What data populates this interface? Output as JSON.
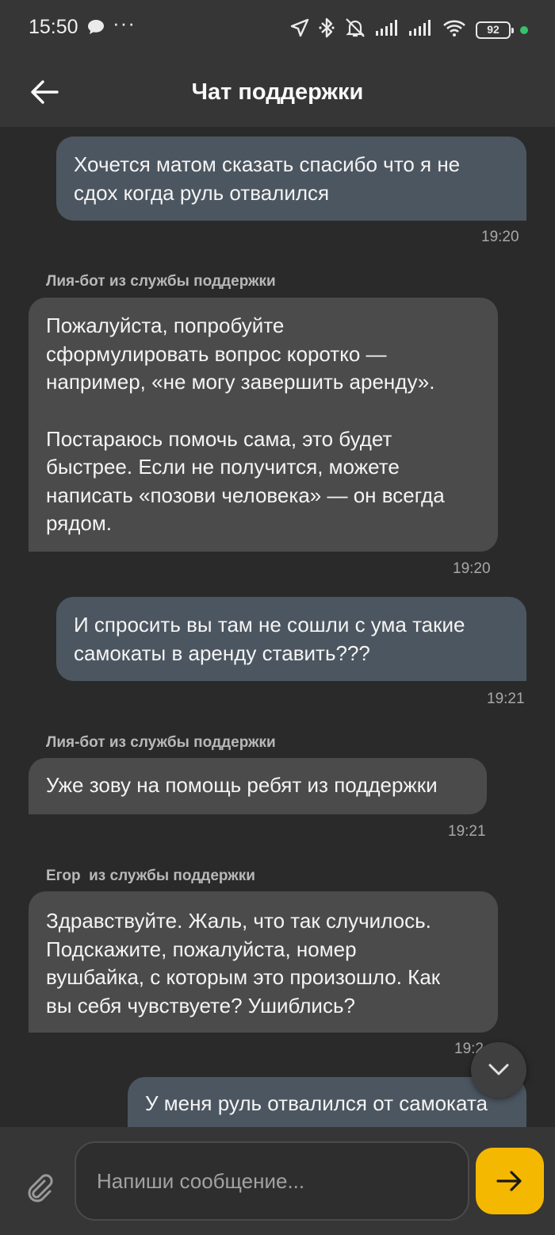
{
  "status_bar": {
    "time": "15:50",
    "battery": "92",
    "icons": [
      "chat-bubble-icon",
      "more-dots-icon",
      "location-icon",
      "bluetooth-icon",
      "muted-bell-icon",
      "signal-icon",
      "signal-icon",
      "wifi-icon",
      "battery-icon"
    ],
    "dots": "···"
  },
  "header": {
    "title": "Чат поддержки",
    "back_icon": "back-arrow-icon"
  },
  "messages": [
    {
      "from": "user",
      "lines": [
        "Хочется матом сказать спасибо что я не",
        "сдох когда руль отвалился"
      ],
      "time": "19:20"
    },
    {
      "from": "bot",
      "sender": "Лия-бот из службы поддержки",
      "para1": [
        "Пожалуйста, попробуйте",
        "сформулировать вопрос коротко —",
        "например, «не могу завершить аренду»."
      ],
      "para2": [
        "Постараюсь помочь сама, это будет",
        "быстрее. Если не получится, можете",
        "написать «позови человека» — он всегда",
        "рядом."
      ],
      "time": "19:20"
    },
    {
      "from": "user",
      "lines": [
        "И спросить вы там не сошли с ума такие",
        "самокаты в аренду ставить???"
      ],
      "time": "19:21"
    },
    {
      "from": "bot",
      "sender": "Лия-бот из службы поддержки",
      "lines": [
        "Уже зову на помощь ребят из поддержки"
      ],
      "time": "19:21"
    },
    {
      "from": "agent",
      "sender": "Егор  из службы поддержки",
      "lines": [
        "Здравствуйте. Жаль, что так случилось.",
        "Подскажите, пожалуйста, номер",
        "вушбайка, с которым это произошло. Как",
        "вы себя чувствуете? Ушиблись?"
      ],
      "time": "19:2"
    },
    {
      "from": "user",
      "lines": [
        "У меня руль отвалился от самоката"
      ]
    }
  ],
  "composer": {
    "placeholder": "Напиши сообщение...",
    "attach_icon": "paperclip-icon",
    "send_icon": "send-arrow-icon"
  },
  "colors": {
    "background": "#2a2a2a",
    "bar": "#363636",
    "user_bubble": "#4c5660",
    "bot_bubble": "#4b4b4b",
    "accent": "#f5b800"
  }
}
